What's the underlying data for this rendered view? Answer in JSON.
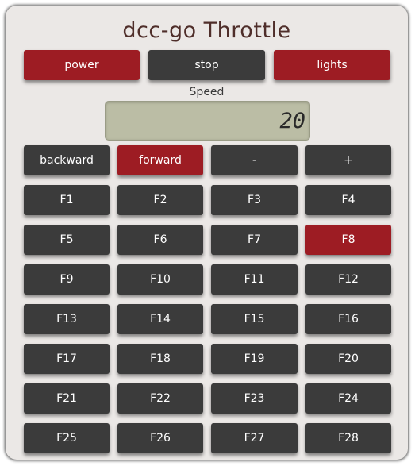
{
  "app": {
    "title": "dcc-go Throttle"
  },
  "controls": {
    "power_label": "power",
    "stop_label": "stop",
    "lights_label": "lights"
  },
  "speed": {
    "label": "Speed",
    "value": "20"
  },
  "direction": {
    "backward_label": "backward",
    "forward_label": "forward",
    "minus_label": "-",
    "plus_label": "+"
  },
  "functions": [
    {
      "label": "F1",
      "active": false
    },
    {
      "label": "F2",
      "active": false
    },
    {
      "label": "F3",
      "active": false
    },
    {
      "label": "F4",
      "active": false
    },
    {
      "label": "F5",
      "active": false
    },
    {
      "label": "F6",
      "active": false
    },
    {
      "label": "F7",
      "active": false
    },
    {
      "label": "F8",
      "active": true
    },
    {
      "label": "F9",
      "active": false
    },
    {
      "label": "F10",
      "active": false
    },
    {
      "label": "F11",
      "active": false
    },
    {
      "label": "F12",
      "active": false
    },
    {
      "label": "F13",
      "active": false
    },
    {
      "label": "F14",
      "active": false
    },
    {
      "label": "F15",
      "active": false
    },
    {
      "label": "F16",
      "active": false
    },
    {
      "label": "F17",
      "active": false
    },
    {
      "label": "F18",
      "active": false
    },
    {
      "label": "F19",
      "active": false
    },
    {
      "label": "F20",
      "active": false
    },
    {
      "label": "F21",
      "active": false
    },
    {
      "label": "F22",
      "active": false
    },
    {
      "label": "F23",
      "active": false
    },
    {
      "label": "F24",
      "active": false
    },
    {
      "label": "F25",
      "active": false
    },
    {
      "label": "F26",
      "active": false
    },
    {
      "label": "F27",
      "active": false
    },
    {
      "label": "F28",
      "active": false
    }
  ],
  "colors": {
    "active": "#9d1c23",
    "inactive": "#3b3b3b",
    "title": "#4f2e2a",
    "display": "#bbbda5"
  }
}
